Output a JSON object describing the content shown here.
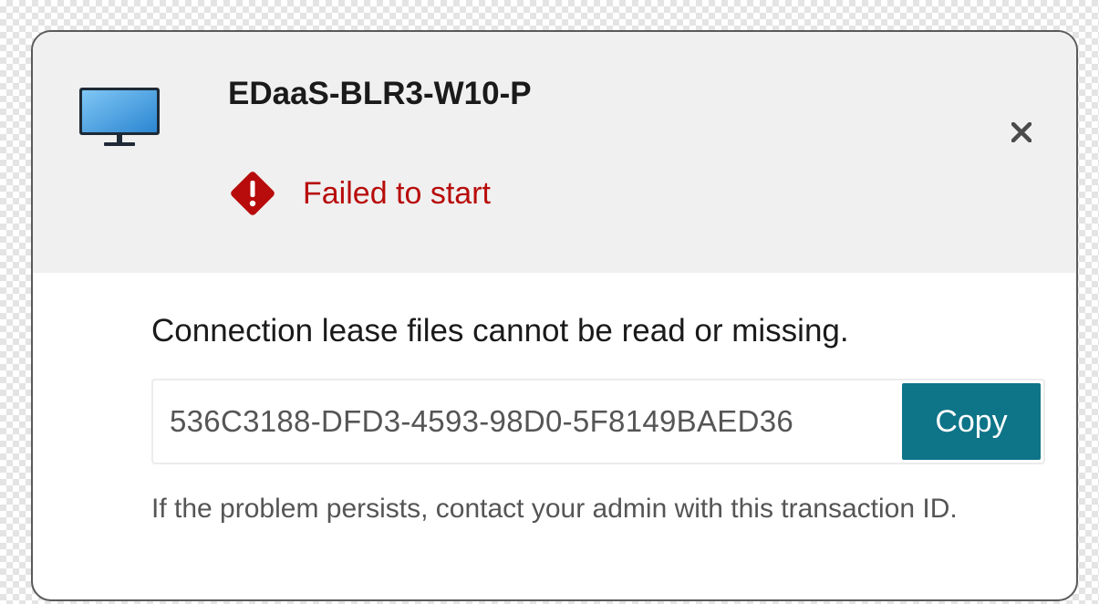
{
  "dialog": {
    "title": "EDaaS-BLR3-W10-P",
    "status_text": "Failed to start",
    "message": "Connection lease files cannot be read or missing.",
    "transaction_id": "536C3188-DFD3-4593-98D0-5F8149BAED36",
    "copy_label": "Copy",
    "help_text": "If the problem persists, contact your admin with this transaction ID."
  },
  "icons": {
    "desktop": "desktop-monitor-icon",
    "status": "error-diamond-icon",
    "close": "close-icon"
  },
  "colors": {
    "error": "#b80b0b",
    "accent": "#0e7488",
    "header_bg": "#f0f0f0"
  }
}
